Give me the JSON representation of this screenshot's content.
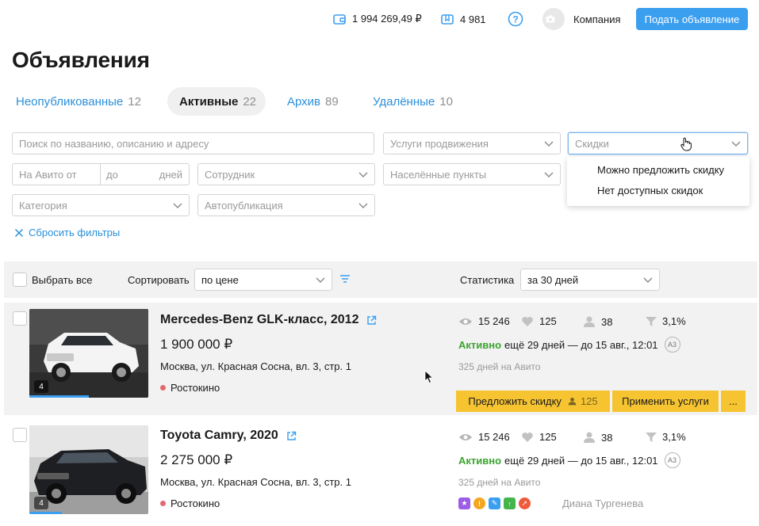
{
  "header": {
    "wallet": "1 994 269,49 ₽",
    "bonus": "4 981",
    "company": "Компания",
    "post_button": "Подать объявление"
  },
  "page_title": "Объявления",
  "tabs": [
    {
      "label": "Неопубликованные",
      "count": "12"
    },
    {
      "label": "Активные",
      "count": "22"
    },
    {
      "label": "Архив",
      "count": "89"
    },
    {
      "label": "Удалённые",
      "count": "10"
    }
  ],
  "filters": {
    "search_placeholder": "Поиск по названию, описанию и адресу",
    "promo_services": "Услуги продвижения",
    "discounts": "Скидки",
    "on_avito_from": "На Авито от",
    "to": "до",
    "days": "дней",
    "employee": "Сотрудник",
    "localities": "Населённые пункты",
    "category": "Категория",
    "autopublish": "Автопубликация",
    "reset": "Сбросить фильтры"
  },
  "discount_options": [
    "Можно предложить скидку",
    "Нет доступных скидок"
  ],
  "list_header": {
    "select_all": "Выбрать все",
    "sort_label": "Сортировать",
    "sort_value": "по цене",
    "stats_label": "Статистика",
    "stats_value": "за 30 дней"
  },
  "listings": [
    {
      "title": "Mercedes-Benz GLK-класс, 2012",
      "price": "1 900 000 ₽",
      "address": "Москва, ул. Красная Сосна, вл. 3, стр. 1",
      "metro": "Ростокино",
      "photo_count": "4",
      "photo_progress": 0.5,
      "views": "15 246",
      "favorites": "125",
      "contacts": "38",
      "conversion": "3,1%",
      "status": "Активно",
      "status_text": "ещё 29 дней — до 15 авг., 12:01",
      "badge": "A3",
      "days_on_avito": "325 дней на Авито",
      "offer_discount": "Предложить скидку",
      "offer_count": "125",
      "apply_services": "Применить услуги",
      "more": "..."
    },
    {
      "title": "Toyota Camry, 2020",
      "price": "2 275 000 ₽",
      "address": "Москва, ул. Красная Сосна, вл. 3, стр. 1",
      "metro": "Ростокино",
      "photo_count": "4",
      "photo_progress": 0.27,
      "views": "15 246",
      "favorites": "125",
      "contacts": "38",
      "conversion": "3,1%",
      "status": "Активно",
      "status_text": "ещё 29 дней — до 15 авг., 12:01",
      "badge": "A3",
      "days_on_avito": "325 дней на Авито",
      "employee": "Диана Тургенева"
    }
  ],
  "colors": {
    "accent": "#3b9ff0",
    "link": "#2b8fd9",
    "active": "#3aa42e",
    "yellow_button": "#f7c431",
    "metro_dot": "#e4696e"
  }
}
